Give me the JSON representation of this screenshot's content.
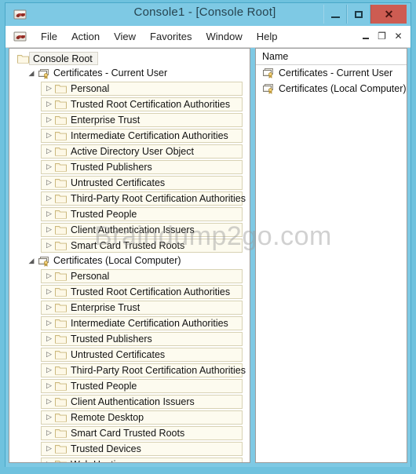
{
  "window": {
    "title": "Console1 - [Console Root]",
    "icon": "mmc-console-icon",
    "controls": {
      "minimize": "minimize-button",
      "maximize": "maximize-button",
      "close": "✕"
    }
  },
  "menubar": {
    "icon": "mmc-console-icon",
    "items": [
      {
        "label": "File"
      },
      {
        "label": "Action"
      },
      {
        "label": "View"
      },
      {
        "label": "Favorites"
      },
      {
        "label": "Window"
      },
      {
        "label": "Help"
      }
    ],
    "mdi_controls": {
      "minimize": "minimize-child-button",
      "restore": "❐",
      "close": "✕"
    }
  },
  "tree": {
    "root": {
      "label": "Console Root",
      "icon": "folder-icon"
    },
    "snapins": [
      {
        "label": "Certificates - Current User",
        "icon": "certificates-snapin-icon",
        "expander": "◢",
        "stores": [
          {
            "label": "Personal"
          },
          {
            "label": "Trusted Root Certification Authorities"
          },
          {
            "label": "Enterprise Trust"
          },
          {
            "label": "Intermediate Certification Authorities"
          },
          {
            "label": "Active Directory User Object"
          },
          {
            "label": "Trusted Publishers"
          },
          {
            "label": "Untrusted Certificates"
          },
          {
            "label": "Third-Party Root Certification Authorities"
          },
          {
            "label": "Trusted People"
          },
          {
            "label": "Client Authentication Issuers"
          },
          {
            "label": "Smart Card Trusted Roots"
          }
        ]
      },
      {
        "label": "Certificates (Local Computer)",
        "icon": "certificates-snapin-icon",
        "expander": "◢",
        "stores": [
          {
            "label": "Personal"
          },
          {
            "label": "Trusted Root Certification Authorities"
          },
          {
            "label": "Enterprise Trust"
          },
          {
            "label": "Intermediate Certification Authorities"
          },
          {
            "label": "Trusted Publishers"
          },
          {
            "label": "Untrusted Certificates"
          },
          {
            "label": "Third-Party Root Certification Authorities"
          },
          {
            "label": "Trusted People"
          },
          {
            "label": "Client Authentication Issuers"
          },
          {
            "label": "Remote Desktop"
          },
          {
            "label": "Smart Card Trusted Roots"
          },
          {
            "label": "Trusted Devices"
          },
          {
            "label": "Web Hosting"
          }
        ]
      }
    ],
    "collapsed_glyph": "▷"
  },
  "list_pane": {
    "column_header": "Name",
    "rows": [
      {
        "label": "Certificates - Current User",
        "icon": "certificates-snapin-icon"
      },
      {
        "label": "Certificates (Local Computer)",
        "icon": "certificates-snapin-icon"
      }
    ]
  },
  "watermark": {
    "text": "Braindump2go.com"
  },
  "colors": {
    "titlebar": "#7ec9e4",
    "close_button": "#cd5c52",
    "store_row_bg": "#fdfbef",
    "store_row_border": "#d8d2b4",
    "folder_icon": "#f2e2b8"
  }
}
